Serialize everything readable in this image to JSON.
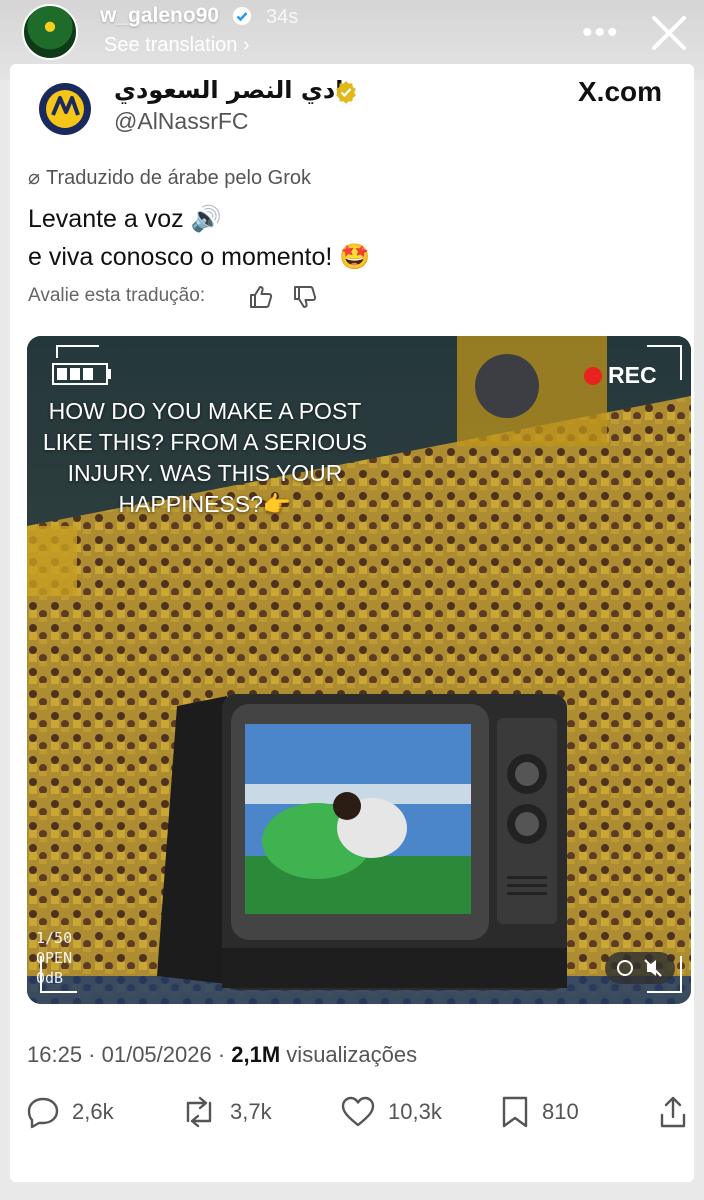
{
  "story": {
    "username": "w_galeno90",
    "time": "34s",
    "see_translation": "See translation",
    "more_menu": "•••"
  },
  "post": {
    "display_name": "نادي النصر السعودي",
    "handle": "@AlNassrFC",
    "site": "X.com",
    "translated_note": "Traduzido de árabe pelo Grok",
    "text_line1": "Levante a voz 🔊",
    "text_line2": "e viva conosco o momento! 🤩",
    "rate_prompt": "Avalie esta tradução:",
    "meta_time": "16:25 · 01/05/2026 · ",
    "meta_views": "2,1M",
    "meta_views_label": " visualizações"
  },
  "media": {
    "rec_label": "REC",
    "overlay_text": "HOW DO YOU MAKE A POST LIKE THIS? FROM A SERIOUS INJURY. WAS THIS YOUR HAPPINESS?👉",
    "stats_line1": "1/50",
    "stats_line2": "OPEN",
    "stats_line3": "0dB"
  },
  "actions": {
    "replies": "2,6k",
    "reposts": "3,7k",
    "likes": "10,3k",
    "bookmarks": "810"
  },
  "colors": {
    "verified_blue": "#1d9bf0",
    "verified_gold": "#e2b719",
    "rec_red": "#e8221d",
    "club_navy": "#1b2a5c",
    "club_yellow": "#f5c518"
  }
}
